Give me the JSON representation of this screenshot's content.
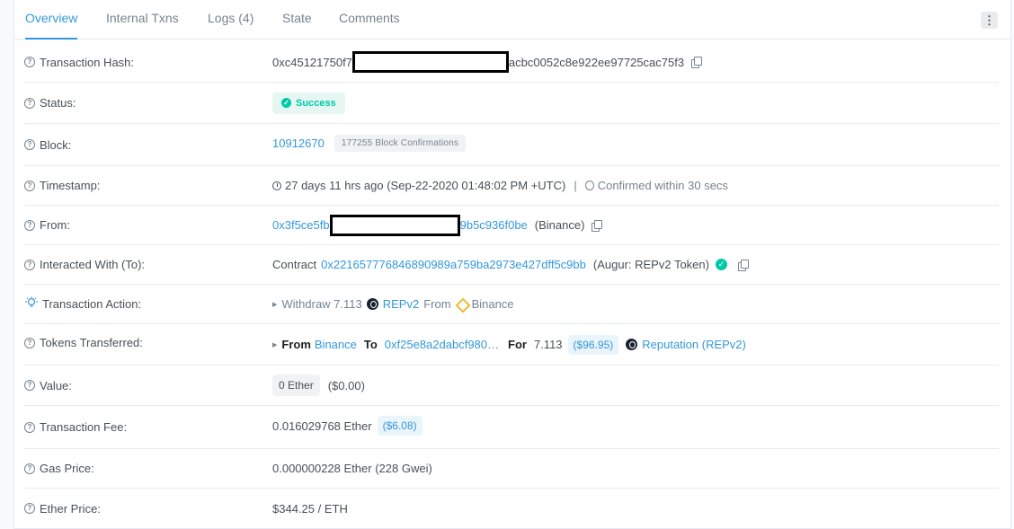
{
  "tabs": [
    {
      "label": "Overview"
    },
    {
      "label": "Internal Txns"
    },
    {
      "label": "Logs (4)"
    },
    {
      "label": "State"
    },
    {
      "label": "Comments"
    }
  ],
  "more_label": "⋮",
  "rows": {
    "tx_hash": {
      "label": "Transaction Hash:",
      "prefix": "0xc45121750f7",
      "suffix": "acbc0052c8e922ee97725cac75f3"
    },
    "status": {
      "label": "Status:",
      "value": "Success"
    },
    "block": {
      "label": "Block:",
      "value": "10912670",
      "confirmations": "177255 Block Confirmations"
    },
    "timestamp": {
      "label": "Timestamp:",
      "value": "27 days 11 hrs ago (Sep-22-2020 01:48:02 PM +UTC)",
      "separator": "|",
      "confirmed": "Confirmed within 30 secs"
    },
    "from": {
      "label": "From:",
      "prefix": "0x3f5ce5fb",
      "suffix": "9b5c936f0be",
      "tag": "(Binance)"
    },
    "to": {
      "label": "Interacted With (To):",
      "contract_word": "Contract",
      "address": "0x221657776846890989a759ba2973e427dff5c9bb",
      "tag": "(Augur: REPv2 Token)"
    },
    "action": {
      "label": "Transaction Action:",
      "verb": "Withdraw 7.113",
      "token": "REPv2",
      "from_word": "From",
      "source": "Binance"
    },
    "tokens": {
      "label": "Tokens Transferred:",
      "from_word": "From",
      "from_value": "Binance",
      "to_word": "To",
      "to_value": "0xf25e8a2dabcf980…",
      "for_word": "For",
      "amount": "7.113",
      "usd": "($96.95)",
      "token_name": "Reputation (REPv2)"
    },
    "value": {
      "label": "Value:",
      "amount": "0 Ether",
      "usd": "($0.00)"
    },
    "fee": {
      "label": "Transaction Fee:",
      "amount": "0.016029768 Ether",
      "usd": "($6.08)"
    },
    "gas": {
      "label": "Gas Price:",
      "value": "0.000000228 Ether (228 Gwei)"
    },
    "ether_price": {
      "label": "Ether Price:",
      "value": "$344.25 / ETH"
    }
  },
  "colors": {
    "accent": "#3498db",
    "success": "#00c9a7",
    "binance": "#f3ba2f"
  }
}
